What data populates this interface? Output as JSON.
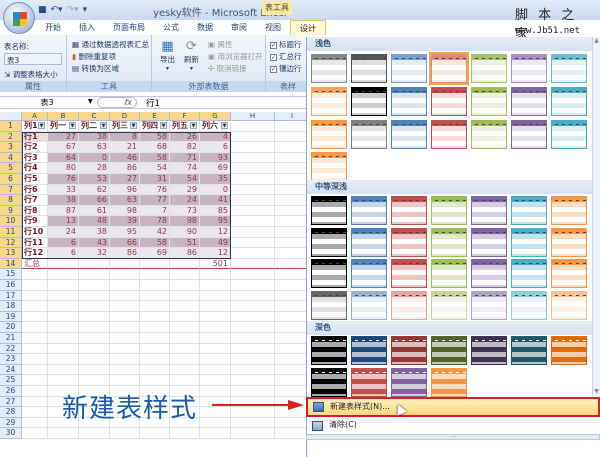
{
  "window": {
    "title": "yesky软件 - Microsoft Excel",
    "context_tab": "表工具"
  },
  "watermark": {
    "line1": "脚 本 之 家",
    "line2": "www.Jb51.net"
  },
  "tabs": [
    {
      "label": "开始"
    },
    {
      "label": "插入"
    },
    {
      "label": "页面布局"
    },
    {
      "label": "公式"
    },
    {
      "label": "数据"
    },
    {
      "label": "审阅"
    },
    {
      "label": "视图"
    },
    {
      "label": "设计",
      "active": true
    }
  ],
  "ribbon": {
    "properties": {
      "table_name_label": "表名称:",
      "table_name_value": "表3",
      "resize": "调整表格大小",
      "group": "属性"
    },
    "tools": {
      "pivot": "通过数据透视表汇总",
      "remove_dup": "删除重复项",
      "convert": "转换为区域",
      "group": "工具"
    },
    "external": {
      "export": "导出",
      "refresh": "刷新",
      "props": "属性",
      "open_browser": "用浏览器打开",
      "unlink": "取消链接",
      "group": "外部表数据"
    },
    "style_options": {
      "header_row": "标题行",
      "total_row": "汇总行",
      "banded_rows": "镶边行",
      "group": "表样",
      "header_checked": true,
      "total_checked": true,
      "banded_checked": true
    }
  },
  "formula_bar": {
    "name_box": "表3",
    "fx": "fx",
    "value": "行1"
  },
  "sheet": {
    "columns": [
      "A",
      "B",
      "C",
      "D",
      "E",
      "F",
      "G",
      "H",
      "I"
    ],
    "table_headers": [
      "列1",
      "列一",
      "列二",
      "列三",
      "列四",
      "列五",
      "列六"
    ],
    "rows": [
      [
        "行1",
        27,
        38,
        8,
        58,
        26,
        4
      ],
      [
        "行2",
        67,
        63,
        21,
        68,
        82,
        6
      ],
      [
        "行3",
        64,
        0,
        46,
        58,
        71,
        93
      ],
      [
        "行4",
        80,
        28,
        86,
        54,
        74,
        69
      ],
      [
        "行5",
        76,
        53,
        27,
        31,
        54,
        35
      ],
      [
        "行6",
        33,
        62,
        96,
        76,
        29,
        0
      ],
      [
        "行7",
        38,
        66,
        63,
        77,
        24,
        41
      ],
      [
        "行8",
        87,
        61,
        98,
        7,
        73,
        85
      ],
      [
        "行9",
        13,
        48,
        39,
        78,
        98,
        95
      ],
      [
        "行10",
        24,
        38,
        95,
        42,
        90,
        12
      ],
      [
        "行11",
        6,
        43,
        66,
        58,
        51,
        49
      ],
      [
        "行12",
        6,
        32,
        86,
        69,
        86,
        12
      ]
    ],
    "total_label": "汇总",
    "total_value": 501,
    "row_count": 30
  },
  "annotation": {
    "text": "新建表样式",
    "arrow_color": "#e02020"
  },
  "gallery": {
    "sections": [
      {
        "title": "浅色",
        "rows": [
          [
            "#888888",
            "#555555",
            "#7a9fd4",
            "#e08a80",
            "#a8c46a",
            "#a58fc4",
            "#6fbfd4"
          ],
          [
            "#f4a460",
            "#000000",
            "#4f81bd",
            "#c0504d",
            "#9bbb59",
            "#8064a2",
            "#4bacc6"
          ],
          [
            "#f79646",
            "#808080",
            "#4f81bd",
            "#c0504d",
            "#9bbb59",
            "#8064a2",
            "#4bacc6"
          ],
          [
            "#f79646"
          ]
        ],
        "selected": [
          0,
          3
        ]
      },
      {
        "title": "中等深浅",
        "rows": [
          [
            "#000000",
            "#4f81bd",
            "#c0504d",
            "#9bbb59",
            "#8064a2",
            "#4bacc6",
            "#f79646"
          ],
          [
            "#000000",
            "#4f81bd",
            "#c0504d",
            "#9bbb59",
            "#8064a2",
            "#4bacc6",
            "#f79646"
          ],
          [
            "#000000",
            "#4f81bd",
            "#c0504d",
            "#9bbb59",
            "#8064a2",
            "#4bacc6",
            "#f79646"
          ],
          [
            "#666666",
            "#95b3d7",
            "#e6a5a3",
            "#c3d69b",
            "#b2a2c7",
            "#92cddc",
            "#fac090"
          ]
        ]
      },
      {
        "title": "深色",
        "rows": [
          [
            "#000000",
            "#1f497d",
            "#953735",
            "#4f6228",
            "#3f3151",
            "#205867",
            "#e46c0a"
          ],
          [
            "#000000",
            "#c0504d",
            "#8064a2",
            "#f79646"
          ]
        ]
      }
    ],
    "menu": {
      "new_style": "新建表样式(N)...",
      "clear": "清除(C)"
    }
  }
}
